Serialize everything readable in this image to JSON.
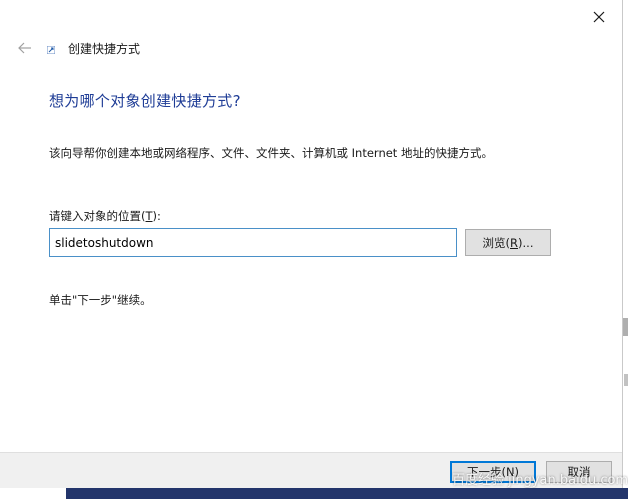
{
  "dialog": {
    "title": "创建快捷方式",
    "heading": "想为哪个对象创建快捷方式?",
    "description": "该向导帮你创建本地或网络程序、文件、文件夹、计算机或 Internet 地址的快捷方式。",
    "field_label_prefix": "请键入对象的位置(",
    "field_label_key": "T",
    "field_label_suffix": "):",
    "location_value": "slidetoshutdown",
    "browse_prefix": "浏览(",
    "browse_key": "R",
    "browse_suffix": ")...",
    "instruction": "单击\"下一步\"继续。",
    "next_label": "下一步(N)",
    "cancel_label": "取消"
  },
  "watermark": "百度经验 jingyan.baidu.com",
  "icons": {
    "close": "close-icon",
    "back": "back-arrow-icon",
    "wizard": "shortcut-wizard-icon"
  },
  "colors": {
    "heading": "#1e3c96",
    "input_border": "#4a90c8",
    "default_button_border": "#0078d7",
    "footer_bg": "#f0f0f0"
  }
}
